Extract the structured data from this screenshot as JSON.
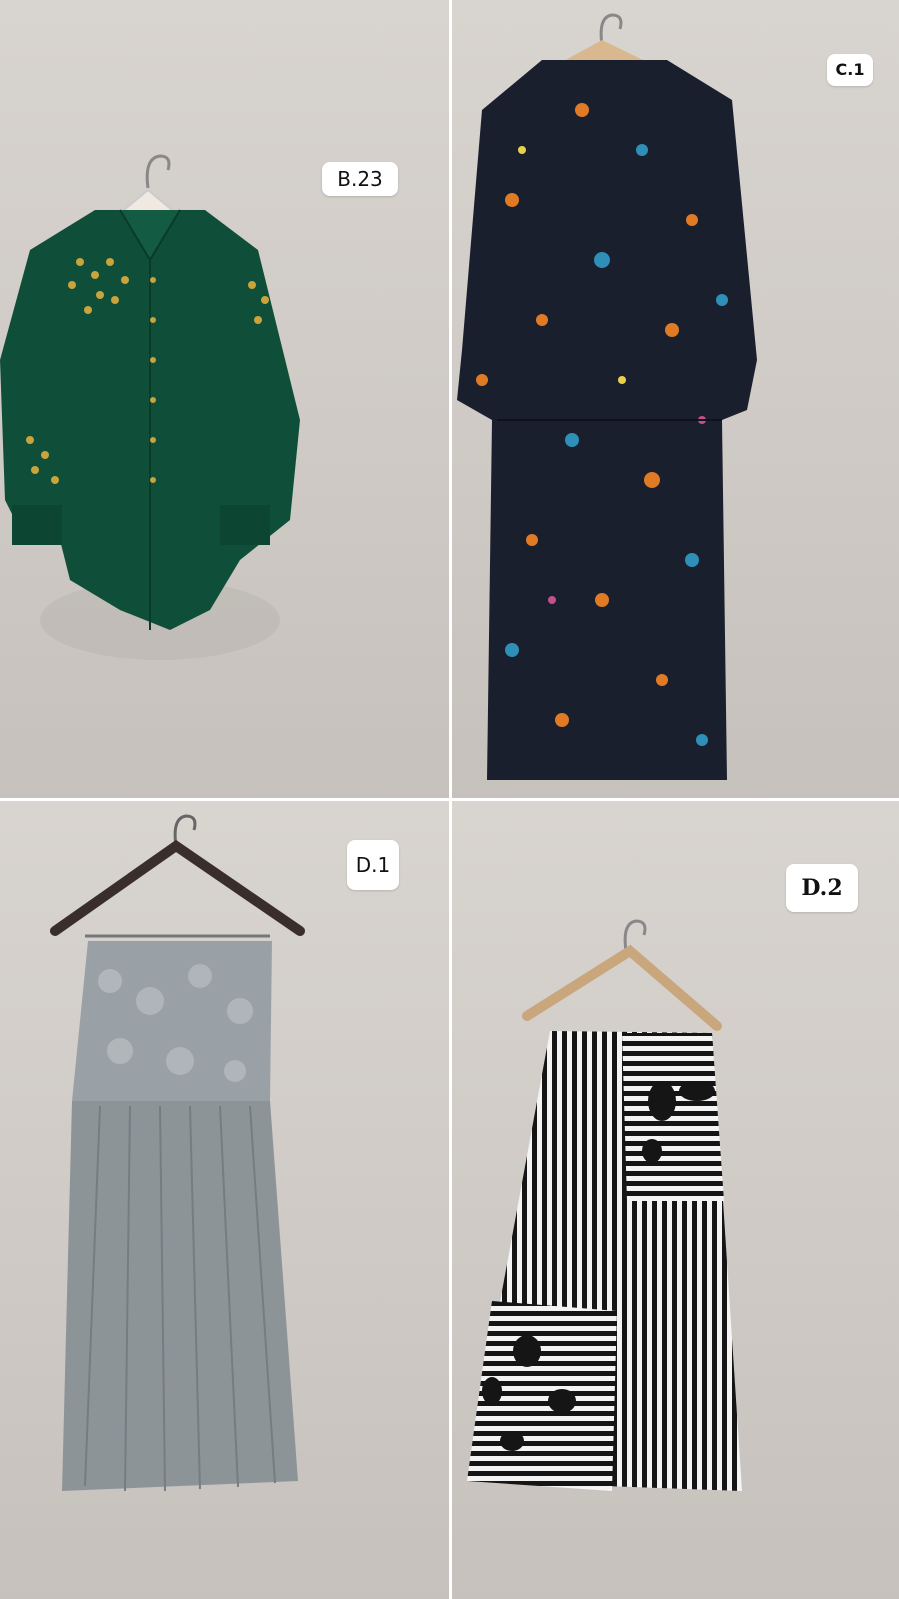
{
  "items": [
    {
      "code": "B.23",
      "garment": "green-shirt"
    },
    {
      "code": "C.1",
      "garment": "floral-dress"
    },
    {
      "code": "D.1",
      "garment": "grey-lace-skirt"
    },
    {
      "code": "D.2",
      "garment": "striped-skirt"
    }
  ],
  "colors": {
    "wall": "#d3cfca",
    "shirt_green": "#0f4f3a",
    "embroidery_gold": "#c9a43a",
    "dress_navy": "#1a1f2e",
    "flower_orange": "#e07a25",
    "flower_blue": "#2e8fb8",
    "skirt_grey": "#8d9498",
    "stripe_black": "#151515",
    "stripe_white": "#f4f4f4",
    "hanger_wood": "#c9a67c"
  }
}
